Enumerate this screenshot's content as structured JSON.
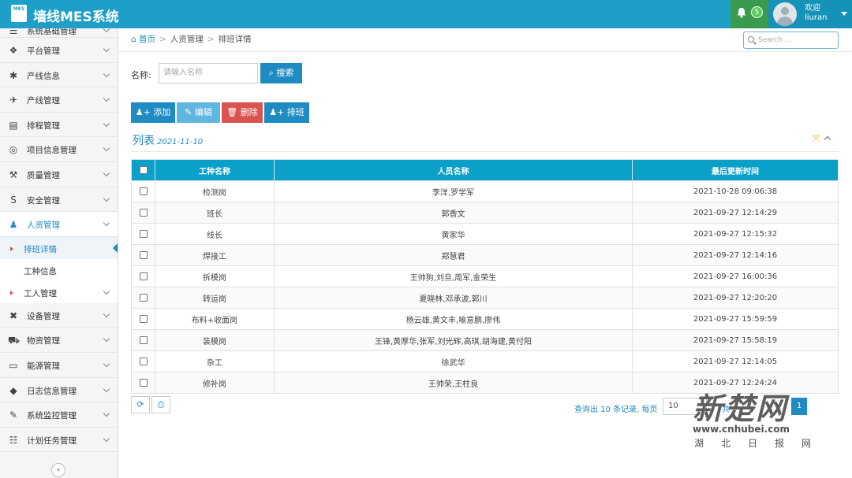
{
  "app": {
    "title": "墙线MES系统",
    "logo_text": "MES"
  },
  "header": {
    "notification_count": "5",
    "welcome": "欢迎",
    "username": "liuran"
  },
  "sidebar": {
    "items": [
      {
        "label": "系统基础管理",
        "icon": "list-icon"
      },
      {
        "label": "平台管理",
        "icon": "cubes-icon"
      },
      {
        "label": "产线信息",
        "icon": "asterisk-icon"
      },
      {
        "label": "产线管理",
        "icon": "paper-plane-icon"
      },
      {
        "label": "排程管理",
        "icon": "server-icon"
      },
      {
        "label": "项目信息管理",
        "icon": "lifebuoy-icon"
      },
      {
        "label": "质量管理",
        "icon": "gavel-icon"
      },
      {
        "label": "安全管理",
        "icon": "shield-icon"
      },
      {
        "label": "人资管理",
        "icon": "person-icon"
      }
    ],
    "subitems": [
      {
        "label": "排班详情"
      },
      {
        "label": "工种信息"
      },
      {
        "label": "工人管理"
      }
    ],
    "items_after": [
      {
        "label": "设备管理",
        "icon": "gear-cross-icon"
      },
      {
        "label": "物资管理",
        "icon": "cart-icon"
      },
      {
        "label": "能源管理",
        "icon": "battery-icon"
      },
      {
        "label": "日志信息管理",
        "icon": "tag-icon"
      },
      {
        "label": "系统监控管理",
        "icon": "edit-icon"
      },
      {
        "label": "计划任务管理",
        "icon": "list-ordered-icon"
      }
    ],
    "collapse_glyph": "«"
  },
  "breadcrumb": {
    "home": "首页",
    "level1": "人资管理",
    "level2": "排班详情"
  },
  "top_search": {
    "placeholder": "Search ..."
  },
  "filter": {
    "name_label": "名称:",
    "name_placeholder": "请输入名称",
    "search_button": "搜索"
  },
  "toolbar": {
    "add": "添加",
    "edit": "编辑",
    "delete": "删除",
    "schedule": "排班"
  },
  "list": {
    "title": "列表",
    "date": "2021-11-10"
  },
  "table": {
    "headers": [
      "工种名称",
      "人员名称",
      "最后更新时间"
    ],
    "rows": [
      [
        "检测岗",
        "李洋,罗学军",
        "2021-10-28 09:06:38"
      ],
      [
        "班长",
        "郭香文",
        "2021-09-27 12:14:29"
      ],
      [
        "线长",
        "黄家华",
        "2021-09-27 12:15:32"
      ],
      [
        "焊接工",
        "郑慧君",
        "2021-09-27 12:14:16"
      ],
      [
        "拆模岗",
        "王帅狗,刘旦,周军,金荣生",
        "2021-09-27 16:00:36"
      ],
      [
        "转运岗",
        "夏晓林,邓承波,郭川",
        "2021-09-27 12:20:20"
      ],
      [
        "布料+收面岗",
        "杨云雄,黄文丰,喻意鹏,廖伟",
        "2021-09-27 15:59:59"
      ],
      [
        "装模岗",
        "王锋,黄厚华,张军,刘光辉,高琪,胡海建,黄付阳",
        "2021-09-27 15:58:19"
      ],
      [
        "杂工",
        "徐武华",
        "2021-09-27 12:14:05"
      ],
      [
        "修补岗",
        "王帅荣,王柱良",
        "2021-09-27 12:24:24"
      ]
    ]
  },
  "pager": {
    "summary": "查询出 10 条记录, 每页",
    "page_size": "10",
    "total_prefix": "共",
    "current_page": "1"
  },
  "watermark": {
    "brand": "新楚网",
    "url": "www.cnhubei.com",
    "sub": "湖北日报网"
  }
}
